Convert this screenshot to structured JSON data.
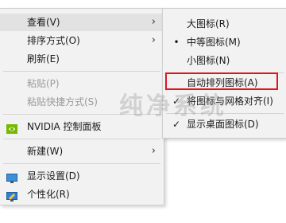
{
  "context_menu": {
    "items": [
      {
        "label": "查看(V)",
        "has_submenu": true,
        "state": "hover"
      },
      {
        "label": "排序方式(O)",
        "has_submenu": true
      },
      {
        "label": "刷新(E)"
      },
      {
        "label": "粘贴(P)",
        "disabled": true
      },
      {
        "label": "粘贴快捷方式(S)",
        "disabled": true
      },
      {
        "label": "NVIDIA 控制面板",
        "icon": "nvidia-icon"
      },
      {
        "label": "新建(W)",
        "has_submenu": true
      },
      {
        "label": "显示设置(D)",
        "icon": "display-settings-icon"
      },
      {
        "label": "个性化(R)",
        "icon": "personalize-icon"
      }
    ],
    "arrow_glyph": "›"
  },
  "view_submenu": {
    "items": [
      {
        "label": "大图标(R)"
      },
      {
        "label": "中等图标(M)",
        "mark": "•"
      },
      {
        "label": "小图标(N)"
      },
      {
        "label": "自动排列图标(A)",
        "highlighted_red_box": true
      },
      {
        "label": "将图标与网格对齐(I)",
        "mark": "✓"
      },
      {
        "label": "显示桌面图标(D)",
        "mark": "✓"
      }
    ]
  },
  "watermark": {
    "text": "纯净系统"
  },
  "colors": {
    "highlight_box": "#e0141e",
    "menu_bg": "#f2f2f2",
    "nvidia": "#76b900"
  }
}
